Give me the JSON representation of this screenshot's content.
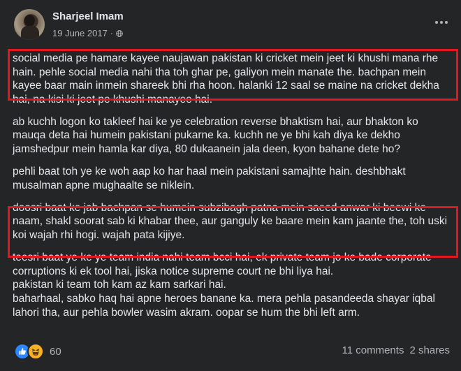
{
  "post": {
    "author": "Sharjeel Imam",
    "date": "19 June 2017",
    "audience_icon": "globe-icon",
    "menu_icon": "ellipsis-icon",
    "paragraphs": [
      "social media pe hamare kayee naujawan pakistan ki cricket mein jeet ki khushi mana rhe hain. pehle social media nahi tha toh ghar pe, galiyon mein manate the. bachpan mein kayee baar main inmein shareek bhi rha hoon. halanki 12 saal se maine na cricket dekha hai, na kisi ki jeet pe khushi manayee hai.",
      "ab kuchh logon ko takleef hai ke ye celebration reverse bhaktism hai, aur bhakton ko mauqa deta hai humein pakistani pukarne ka. kuchh ne ye bhi kah diya ke dekho jamshedpur mein hamla kar diya, 80 dukaanein jala deen, kyon bahane dete ho?",
      "pehli baat toh ye ke woh aap ko har haal mein pakistani samajhte hain. deshbhakt musalman apne mughaalte se niklein.",
      "doosri baat ke jab bachpan se humein subzibagh patna mein saeed anwar ki beewi ke naam, shakl soorat sab ki khabar thee, aur ganguly ke baare mein kam jaante the, toh uski koi wajah rhi hogi. wajah pata kijiye.",
      "teesri baat ye ke ye team india nahi team bcci hai, ek private team jo ke bade corporate corruptions ki ek tool hai, jiska notice supreme court ne bhi liya hai.\npakistan ki team toh kam az kam sarkari hai.\nbaharhaal, sabko haq hai apne heroes banane ka. mera pehla pasandeeda shayar iqbal lahori tha, aur pehla bowler wasim akram. oopar se hum the bhi left arm."
    ]
  },
  "footer": {
    "reaction_icons": [
      "like-icon",
      "haha-icon"
    ],
    "reaction_count": "60",
    "comments": "11 comments",
    "shares": "2 shares"
  },
  "colors": {
    "background": "#242526",
    "text": "#e4e6eb",
    "secondary_text": "#b0b3b8",
    "highlight_box": "#e4171f",
    "like": "#2d88ff",
    "haha": "#f7b125"
  }
}
